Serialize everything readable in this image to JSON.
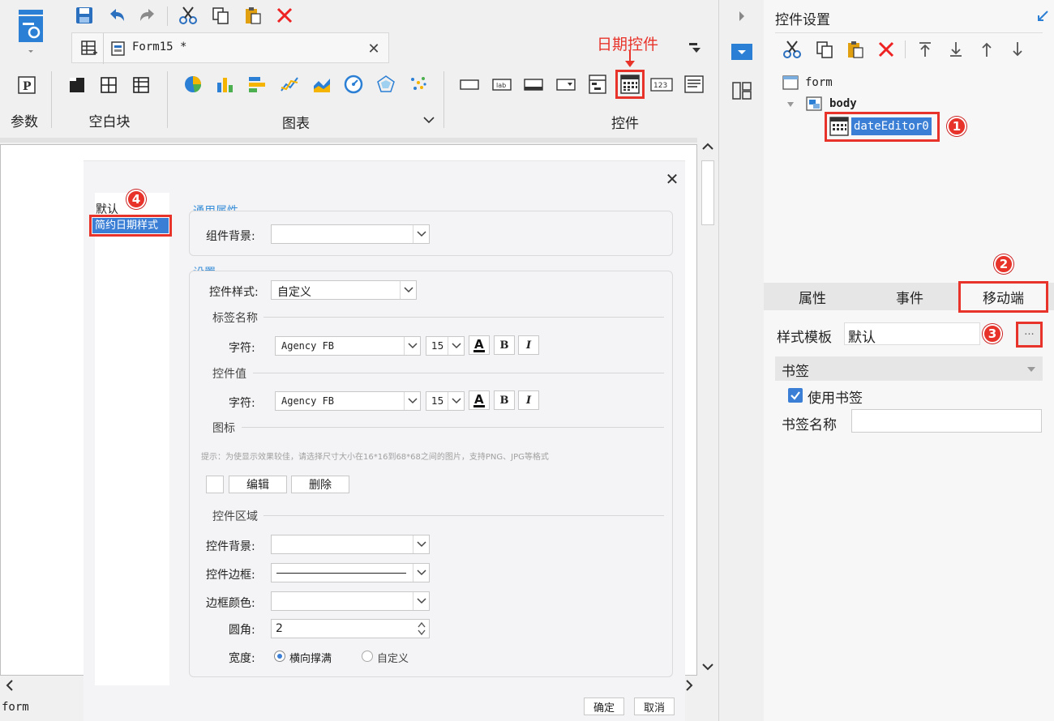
{
  "toolbar": {
    "tab_title": "Form15 *",
    "annotation_date_control": "日期控件"
  },
  "ribbon": {
    "groups": {
      "params": "参数",
      "blank": "空白块",
      "chart": "图表",
      "controls": "控件"
    }
  },
  "dialog": {
    "style_list": [
      "默认",
      "简约日期样式"
    ],
    "general_legend": "通用属性",
    "component_bg_label": "组件背景:",
    "settings_legend": "设置",
    "control_style_label": "控件样式:",
    "control_style_value": "自定义",
    "tag_name_head": "标签名称",
    "char_label": "字符:",
    "font_name": "Agency FB",
    "font_size": "15",
    "bold": "B",
    "italic": "I",
    "control_value_head": "控件值",
    "icon_head": "图标",
    "hint": "提示：为使显示效果较佳，请选择尺寸大小在16*16到68*68之间的图片，支持PNG、JPG等格式",
    "edit_btn": "编辑",
    "delete_btn": "删除",
    "area_head": "控件区域",
    "control_bg_label": "控件背景:",
    "control_border_label": "控件边框:",
    "border_color_label": "边框颜色:",
    "radius_label": "圆角:",
    "radius_value": "2",
    "width_label": "宽度:",
    "width_opt1": "横向撑满",
    "width_opt2": "自定义",
    "ok_btn": "确定",
    "cancel_btn": "取消"
  },
  "status": {
    "bottom_label": "form"
  },
  "right_panel": {
    "title": "控件设置",
    "tree": {
      "form": "form",
      "body": "body",
      "widget": "dateEditor0"
    },
    "tabs": [
      "属性",
      "事件",
      "移动端"
    ],
    "style_template_label": "样式模板",
    "style_template_value": "默认",
    "more_btn": "···",
    "bookmark_section": "书签",
    "use_bookmark": "使用书签",
    "bookmark_name_label": "书签名称"
  },
  "badges": [
    "1",
    "2",
    "3",
    "4"
  ],
  "colors": {
    "accent_blue": "#3b8fd8",
    "annotation_red": "#e8332a",
    "selection_blue": "#3a7fd5"
  }
}
